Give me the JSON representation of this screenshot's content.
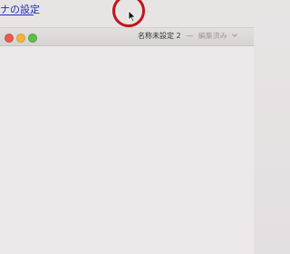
{
  "background_link": {
    "text": "ナの設定"
  },
  "window": {
    "title": "名称未設定 2",
    "separator": "—",
    "status": "編集済み"
  },
  "colors": {
    "highlight_circle": "#c0151b",
    "link": "#1a2fb3",
    "close": "#ea5a4f",
    "minimize": "#f0b63a",
    "zoom": "#5fbd4a"
  },
  "icons": {
    "cursor": "mouse-pointer-icon",
    "title_menu": "chevron-down-icon"
  }
}
